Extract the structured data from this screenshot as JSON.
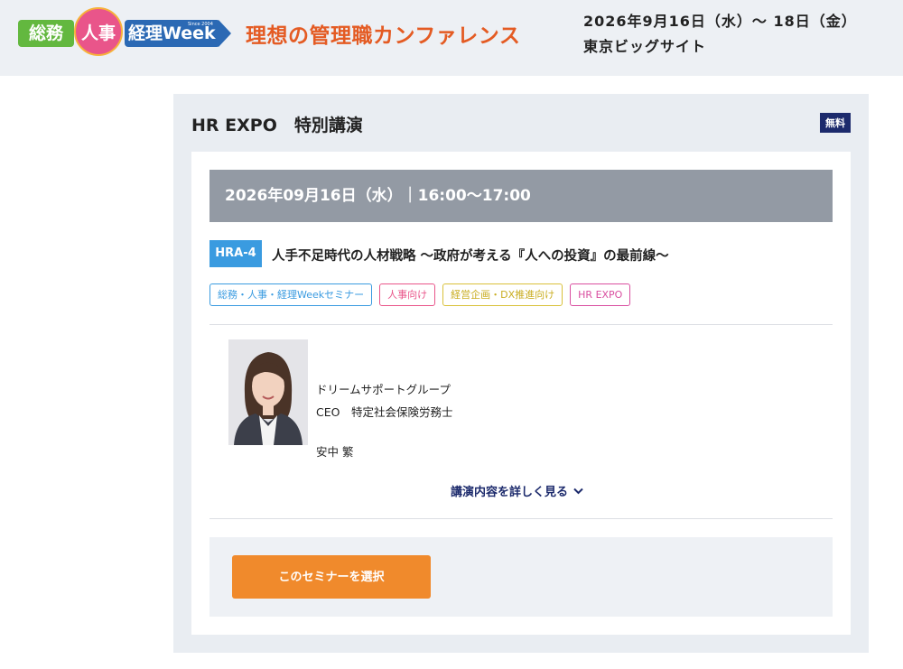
{
  "header": {
    "logo": {
      "soumu": "総務",
      "jinji": "人事",
      "keiri": "経理Week",
      "since": "Since 2004"
    },
    "conference_title": "理想の管理職カンファレンス",
    "event_date": "2026年9月16日（水）～ 18日（金）",
    "event_venue": "東京ビッグサイト"
  },
  "card": {
    "title": "HR EXPO　特別講演",
    "badge": "無料",
    "date_bar": "2026年09月16日（水）｜16:00～17:00",
    "session": {
      "code": "HRA-4",
      "title": "人手不足時代の人材戦略 ～政府が考える『人への投資』の最前線～"
    },
    "tags": [
      {
        "label": "総務・人事・経理Weekセミナー",
        "color": "#3a9be0"
      },
      {
        "label": "人事向け",
        "color": "#e9558a"
      },
      {
        "label": "経営企画・DX推進向け",
        "color": "#d9c13a"
      },
      {
        "label": "HR EXPO",
        "color": "#d94fa0"
      }
    ],
    "speaker": {
      "organization": "ドリームサポートグループ",
      "role": "CEO　特定社会保険労務士",
      "name": "安中 繁"
    },
    "details_link": "講演内容を詳しく見る",
    "select_button": "このセミナーを選択"
  },
  "colors": {
    "accent_orange": "#f08a2c",
    "navy": "#1c2a6c",
    "title_orange": "#e45b23",
    "date_bar": "#939aa4"
  },
  "icons": [
    "chevron-down-icon"
  ]
}
